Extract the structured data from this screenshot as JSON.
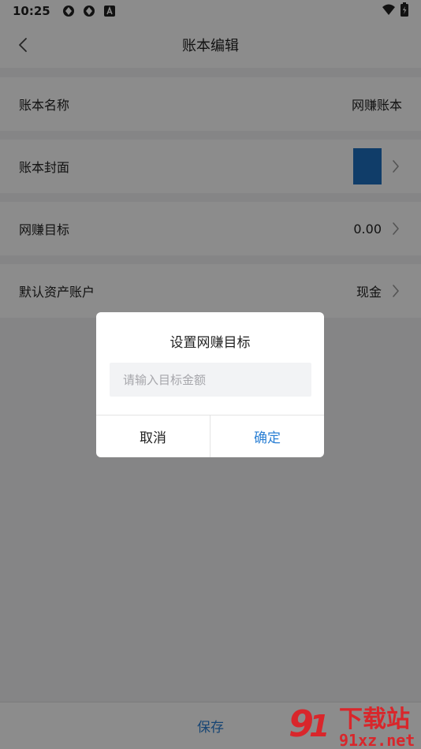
{
  "status_bar": {
    "time": "10:25",
    "icons": [
      "app-sync-icon",
      "app-sync-icon",
      "app-store-icon"
    ],
    "right_icons": [
      "wifi-icon",
      "battery-icon"
    ]
  },
  "header": {
    "title": "账本编辑",
    "back_icon": "back-arrow-icon"
  },
  "settings": {
    "name": {
      "label": "账本名称",
      "value": "网赚账本"
    },
    "cover": {
      "label": "账本封面",
      "swatch_color": "#1e6fc0"
    },
    "target": {
      "label": "网赚目标",
      "value": "0.00"
    },
    "account": {
      "label": "默认资产账户",
      "value": "现金"
    }
  },
  "footer": {
    "save_label": "保存"
  },
  "dialog": {
    "title": "设置网赚目标",
    "input_placeholder": "请输入目标金额",
    "input_value": "",
    "cancel_label": "取消",
    "confirm_label": "确定"
  },
  "watermark": {
    "brand": "下载站",
    "site": "91xz.net"
  },
  "colors": {
    "accent": "#2a7fd4",
    "watermark_red": "#d9262b"
  }
}
